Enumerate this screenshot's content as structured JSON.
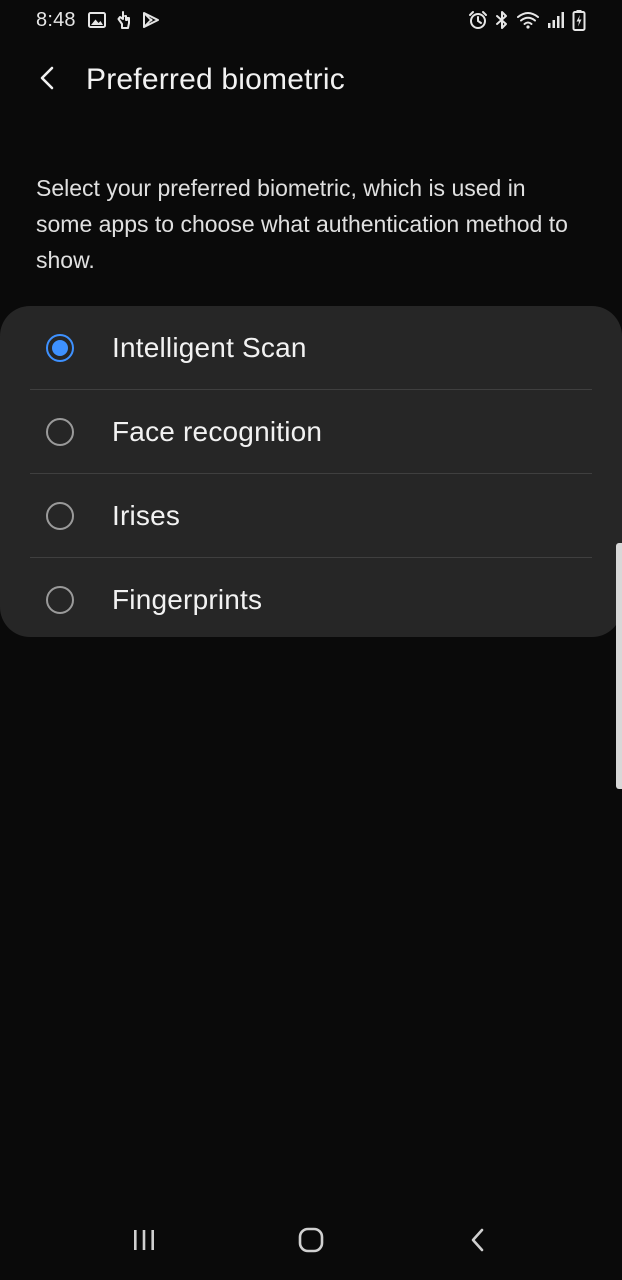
{
  "status_bar": {
    "time": "8:48",
    "left_icons": [
      "gallery-icon",
      "hand-icon",
      "play-store-icon"
    ],
    "right_icons": [
      "alarm-icon",
      "bluetooth-icon",
      "wifi-icon",
      "signal-icon",
      "battery-charging-icon"
    ]
  },
  "header": {
    "title": "Preferred biometric",
    "back_icon": "chevron-left-icon"
  },
  "description": "Select your preferred biometric, which is used in some apps to choose what authentication method to show.",
  "options": [
    {
      "label": "Intelligent Scan",
      "selected": true
    },
    {
      "label": "Face recognition",
      "selected": false
    },
    {
      "label": "Irises",
      "selected": false
    },
    {
      "label": "Fingerprints",
      "selected": false
    }
  ],
  "nav_bar": {
    "buttons": [
      "recent-apps-icon",
      "home-icon",
      "back-icon"
    ]
  },
  "colors": {
    "accent": "#3e91ff",
    "background": "#0a0a0a",
    "card": "#262626",
    "divider": "#3f3f3f"
  }
}
